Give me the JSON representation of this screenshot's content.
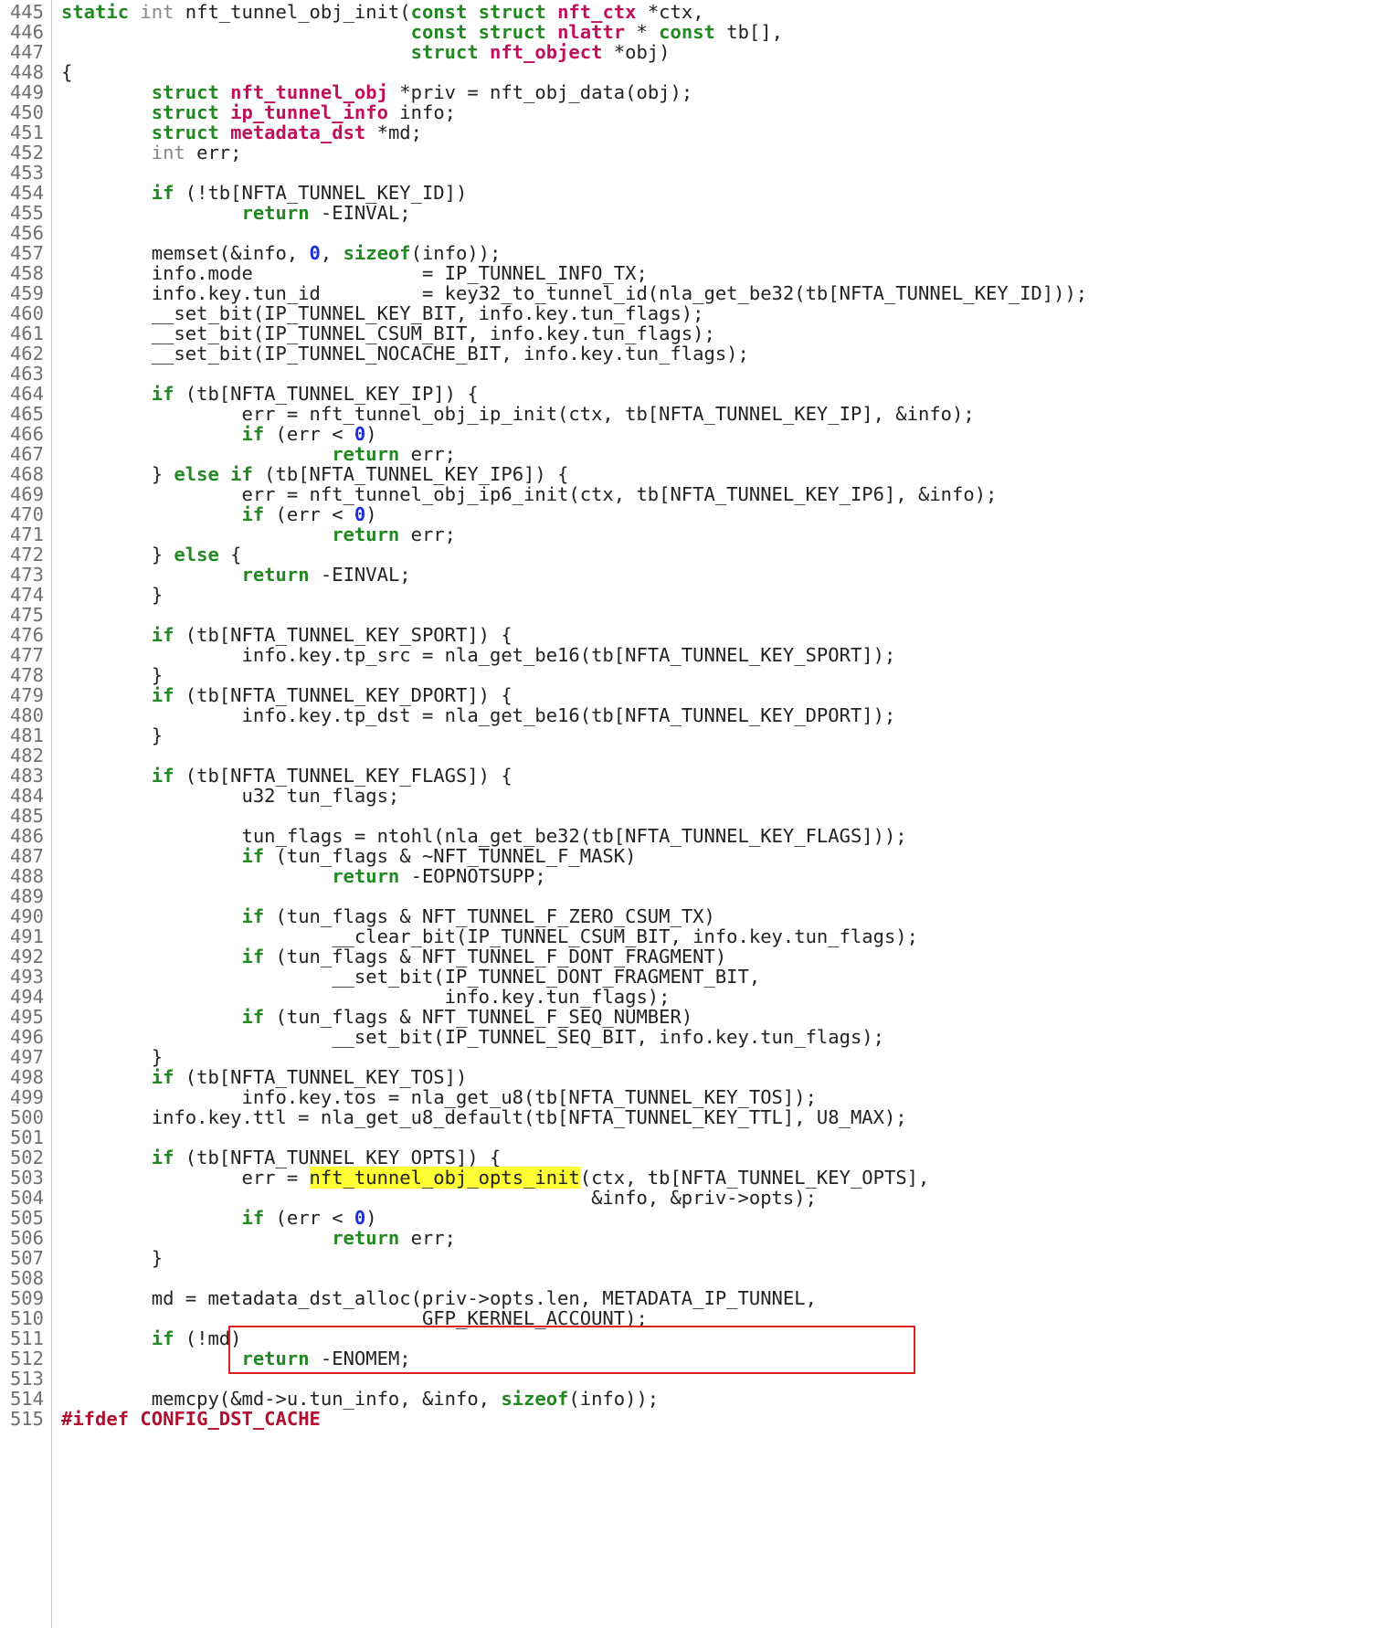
{
  "viewer": {
    "highlight_symbol": "nft_tunnel_obj_opts_init",
    "highlight_color": "#ffff33",
    "box_color": "#e0201c",
    "box_lines": [
      503,
      504
    ]
  },
  "lines": [
    {
      "n": "445",
      "segs": [
        [
          "k",
          "static"
        ],
        [
          "",
          ""
        ],
        [
          "t",
          " int"
        ],
        [
          "",
          " nft_tunnel_obj_init("
        ],
        [
          "k",
          "const"
        ],
        [
          "",
          " "
        ],
        [
          "k",
          "struct"
        ],
        [
          "",
          " "
        ],
        [
          "s",
          "nft_ctx"
        ],
        [
          "",
          " *ctx,"
        ]
      ]
    },
    {
      "n": "446",
      "segs": [
        [
          "",
          "                               "
        ],
        [
          "k",
          "const"
        ],
        [
          "",
          " "
        ],
        [
          "k",
          "struct"
        ],
        [
          "",
          " "
        ],
        [
          "s",
          "nlattr"
        ],
        [
          "",
          " * "
        ],
        [
          "k",
          "const"
        ],
        [
          "",
          " tb[],"
        ]
      ]
    },
    {
      "n": "447",
      "segs": [
        [
          "",
          "                               "
        ],
        [
          "k",
          "struct"
        ],
        [
          "",
          " "
        ],
        [
          "s",
          "nft_object"
        ],
        [
          "",
          " *obj)"
        ]
      ]
    },
    {
      "n": "448",
      "segs": [
        [
          "",
          "{"
        ]
      ]
    },
    {
      "n": "449",
      "segs": [
        [
          "",
          "        "
        ],
        [
          "k",
          "struct"
        ],
        [
          "",
          " "
        ],
        [
          "s",
          "nft_tunnel_obj"
        ],
        [
          "",
          " *priv = nft_obj_data(obj);"
        ]
      ]
    },
    {
      "n": "450",
      "segs": [
        [
          "",
          "        "
        ],
        [
          "k",
          "struct"
        ],
        [
          "",
          " "
        ],
        [
          "s",
          "ip_tunnel_info"
        ],
        [
          "",
          " info;"
        ]
      ]
    },
    {
      "n": "451",
      "segs": [
        [
          "",
          "        "
        ],
        [
          "k",
          "struct"
        ],
        [
          "",
          " "
        ],
        [
          "s",
          "metadata_dst"
        ],
        [
          "",
          " *md;"
        ]
      ]
    },
    {
      "n": "452",
      "segs": [
        [
          "",
          "        "
        ],
        [
          "t",
          "int"
        ],
        [
          "",
          " err;"
        ]
      ]
    },
    {
      "n": "453",
      "segs": [
        [
          "",
          ""
        ]
      ]
    },
    {
      "n": "454",
      "segs": [
        [
          "",
          "        "
        ],
        [
          "k",
          "if"
        ],
        [
          "",
          " (!tb[NFTA_TUNNEL_KEY_ID])"
        ]
      ]
    },
    {
      "n": "455",
      "segs": [
        [
          "",
          "                "
        ],
        [
          "k",
          "return"
        ],
        [
          "",
          " -EINVAL;"
        ]
      ]
    },
    {
      "n": "456",
      "segs": [
        [
          "",
          ""
        ]
      ]
    },
    {
      "n": "457",
      "segs": [
        [
          "",
          "        memset(&info, "
        ],
        [
          "n",
          "0"
        ],
        [
          "",
          ", "
        ],
        [
          "k",
          "sizeof"
        ],
        [
          "",
          "(info));"
        ]
      ]
    },
    {
      "n": "458",
      "segs": [
        [
          "",
          "        info.mode               = IP_TUNNEL_INFO_TX;"
        ]
      ]
    },
    {
      "n": "459",
      "segs": [
        [
          "",
          "        info.key.tun_id         = key32_to_tunnel_id(nla_get_be32(tb[NFTA_TUNNEL_KEY_ID]));"
        ]
      ]
    },
    {
      "n": "460",
      "segs": [
        [
          "",
          "        __set_bit(IP_TUNNEL_KEY_BIT, info.key.tun_flags);"
        ]
      ]
    },
    {
      "n": "461",
      "segs": [
        [
          "",
          "        __set_bit(IP_TUNNEL_CSUM_BIT, info.key.tun_flags);"
        ]
      ]
    },
    {
      "n": "462",
      "segs": [
        [
          "",
          "        __set_bit(IP_TUNNEL_NOCACHE_BIT, info.key.tun_flags);"
        ]
      ]
    },
    {
      "n": "463",
      "segs": [
        [
          "",
          ""
        ]
      ]
    },
    {
      "n": "464",
      "segs": [
        [
          "",
          "        "
        ],
        [
          "k",
          "if"
        ],
        [
          "",
          " (tb[NFTA_TUNNEL_KEY_IP]) {"
        ]
      ]
    },
    {
      "n": "465",
      "segs": [
        [
          "",
          "                err = nft_tunnel_obj_ip_init(ctx, tb[NFTA_TUNNEL_KEY_IP], &info);"
        ]
      ]
    },
    {
      "n": "466",
      "segs": [
        [
          "",
          "                "
        ],
        [
          "k",
          "if"
        ],
        [
          "",
          " (err < "
        ],
        [
          "n",
          "0"
        ],
        [
          "",
          ")"
        ]
      ]
    },
    {
      "n": "467",
      "segs": [
        [
          "",
          "                        "
        ],
        [
          "k",
          "return"
        ],
        [
          "",
          " err;"
        ]
      ]
    },
    {
      "n": "468",
      "segs": [
        [
          "",
          "        } "
        ],
        [
          "k",
          "else"
        ],
        [
          "",
          " "
        ],
        [
          "k",
          "if"
        ],
        [
          "",
          " (tb[NFTA_TUNNEL_KEY_IP6]) {"
        ]
      ]
    },
    {
      "n": "469",
      "segs": [
        [
          "",
          "                err = nft_tunnel_obj_ip6_init(ctx, tb[NFTA_TUNNEL_KEY_IP6], &info);"
        ]
      ]
    },
    {
      "n": "470",
      "segs": [
        [
          "",
          "                "
        ],
        [
          "k",
          "if"
        ],
        [
          "",
          " (err < "
        ],
        [
          "n",
          "0"
        ],
        [
          "",
          ")"
        ]
      ]
    },
    {
      "n": "471",
      "segs": [
        [
          "",
          "                        "
        ],
        [
          "k",
          "return"
        ],
        [
          "",
          " err;"
        ]
      ]
    },
    {
      "n": "472",
      "segs": [
        [
          "",
          "        } "
        ],
        [
          "k",
          "else"
        ],
        [
          "",
          " {"
        ]
      ]
    },
    {
      "n": "473",
      "segs": [
        [
          "",
          "                "
        ],
        [
          "k",
          "return"
        ],
        [
          "",
          " -EINVAL;"
        ]
      ]
    },
    {
      "n": "474",
      "segs": [
        [
          "",
          "        }"
        ]
      ]
    },
    {
      "n": "475",
      "segs": [
        [
          "",
          ""
        ]
      ]
    },
    {
      "n": "476",
      "segs": [
        [
          "",
          "        "
        ],
        [
          "k",
          "if"
        ],
        [
          "",
          " (tb[NFTA_TUNNEL_KEY_SPORT]) {"
        ]
      ]
    },
    {
      "n": "477",
      "segs": [
        [
          "",
          "                info.key.tp_src = nla_get_be16(tb[NFTA_TUNNEL_KEY_SPORT]);"
        ]
      ]
    },
    {
      "n": "478",
      "segs": [
        [
          "",
          "        }"
        ]
      ]
    },
    {
      "n": "479",
      "segs": [
        [
          "",
          "        "
        ],
        [
          "k",
          "if"
        ],
        [
          "",
          " (tb[NFTA_TUNNEL_KEY_DPORT]) {"
        ]
      ]
    },
    {
      "n": "480",
      "segs": [
        [
          "",
          "                info.key.tp_dst = nla_get_be16(tb[NFTA_TUNNEL_KEY_DPORT]);"
        ]
      ]
    },
    {
      "n": "481",
      "segs": [
        [
          "",
          "        }"
        ]
      ]
    },
    {
      "n": "482",
      "segs": [
        [
          "",
          ""
        ]
      ]
    },
    {
      "n": "483",
      "segs": [
        [
          "",
          "        "
        ],
        [
          "k",
          "if"
        ],
        [
          "",
          " (tb[NFTA_TUNNEL_KEY_FLAGS]) {"
        ]
      ]
    },
    {
      "n": "484",
      "segs": [
        [
          "",
          "                u32 tun_flags;"
        ]
      ]
    },
    {
      "n": "485",
      "segs": [
        [
          "",
          ""
        ]
      ]
    },
    {
      "n": "486",
      "segs": [
        [
          "",
          "                tun_flags = ntohl(nla_get_be32(tb[NFTA_TUNNEL_KEY_FLAGS]));"
        ]
      ]
    },
    {
      "n": "487",
      "segs": [
        [
          "",
          "                "
        ],
        [
          "k",
          "if"
        ],
        [
          "",
          " (tun_flags & ~NFT_TUNNEL_F_MASK)"
        ]
      ]
    },
    {
      "n": "488",
      "segs": [
        [
          "",
          "                        "
        ],
        [
          "k",
          "return"
        ],
        [
          "",
          " -EOPNOTSUPP;"
        ]
      ]
    },
    {
      "n": "489",
      "segs": [
        [
          "",
          ""
        ]
      ]
    },
    {
      "n": "490",
      "segs": [
        [
          "",
          "                "
        ],
        [
          "k",
          "if"
        ],
        [
          "",
          " (tun_flags & NFT_TUNNEL_F_ZERO_CSUM_TX)"
        ]
      ]
    },
    {
      "n": "491",
      "segs": [
        [
          "",
          "                        __clear_bit(IP_TUNNEL_CSUM_BIT, info.key.tun_flags);"
        ]
      ]
    },
    {
      "n": "492",
      "segs": [
        [
          "",
          "                "
        ],
        [
          "k",
          "if"
        ],
        [
          "",
          " (tun_flags & NFT_TUNNEL_F_DONT_FRAGMENT)"
        ]
      ]
    },
    {
      "n": "493",
      "segs": [
        [
          "",
          "                        __set_bit(IP_TUNNEL_DONT_FRAGMENT_BIT,"
        ]
      ]
    },
    {
      "n": "494",
      "segs": [
        [
          "",
          "                                  info.key.tun_flags);"
        ]
      ]
    },
    {
      "n": "495",
      "segs": [
        [
          "",
          "                "
        ],
        [
          "k",
          "if"
        ],
        [
          "",
          " (tun_flags & NFT_TUNNEL_F_SEQ_NUMBER)"
        ]
      ]
    },
    {
      "n": "496",
      "segs": [
        [
          "",
          "                        __set_bit(IP_TUNNEL_SEQ_BIT, info.key.tun_flags);"
        ]
      ]
    },
    {
      "n": "497",
      "segs": [
        [
          "",
          "        }"
        ]
      ]
    },
    {
      "n": "498",
      "segs": [
        [
          "",
          "        "
        ],
        [
          "k",
          "if"
        ],
        [
          "",
          " (tb[NFTA_TUNNEL_KEY_TOS])"
        ]
      ]
    },
    {
      "n": "499",
      "segs": [
        [
          "",
          "                info.key.tos = nla_get_u8(tb[NFTA_TUNNEL_KEY_TOS]);"
        ]
      ]
    },
    {
      "n": "500",
      "segs": [
        [
          "",
          "        info.key.ttl = nla_get_u8_default(tb[NFTA_TUNNEL_KEY_TTL], U8_MAX);"
        ]
      ]
    },
    {
      "n": "501",
      "segs": [
        [
          "",
          ""
        ]
      ]
    },
    {
      "n": "502",
      "segs": [
        [
          "",
          "        "
        ],
        [
          "k",
          "if"
        ],
        [
          "",
          " (tb[NFTA_TUNNEL_KEY_OPTS]) {"
        ]
      ]
    },
    {
      "n": "503",
      "segs": [
        [
          "",
          "                err = "
        ],
        [
          "hl",
          "nft_tunnel_obj_opts_init"
        ],
        [
          "",
          "(ctx, tb[NFTA_TUNNEL_KEY_OPTS],"
        ]
      ]
    },
    {
      "n": "504",
      "segs": [
        [
          "",
          "                                               &info, &priv->opts);"
        ]
      ]
    },
    {
      "n": "505",
      "segs": [
        [
          "",
          "                "
        ],
        [
          "k",
          "if"
        ],
        [
          "",
          " (err < "
        ],
        [
          "n",
          "0"
        ],
        [
          "",
          ")"
        ]
      ]
    },
    {
      "n": "506",
      "segs": [
        [
          "",
          "                        "
        ],
        [
          "k",
          "return"
        ],
        [
          "",
          " err;"
        ]
      ]
    },
    {
      "n": "507",
      "segs": [
        [
          "",
          "        }"
        ]
      ]
    },
    {
      "n": "508",
      "segs": [
        [
          "",
          ""
        ]
      ]
    },
    {
      "n": "509",
      "segs": [
        [
          "",
          "        md = metadata_dst_alloc(priv->opts.len, METADATA_IP_TUNNEL,"
        ]
      ]
    },
    {
      "n": "510",
      "segs": [
        [
          "",
          "                                GFP_KERNEL_ACCOUNT);"
        ]
      ]
    },
    {
      "n": "511",
      "segs": [
        [
          "",
          "        "
        ],
        [
          "k",
          "if"
        ],
        [
          "",
          " (!md)"
        ]
      ]
    },
    {
      "n": "512",
      "segs": [
        [
          "",
          "                "
        ],
        [
          "k",
          "return"
        ],
        [
          "",
          " -ENOMEM;"
        ]
      ]
    },
    {
      "n": "513",
      "segs": [
        [
          "",
          ""
        ]
      ]
    },
    {
      "n": "514",
      "segs": [
        [
          "",
          "        memcpy(&md->u.tun_info, &info, "
        ],
        [
          "k",
          "sizeof"
        ],
        [
          "",
          "(info));"
        ]
      ]
    },
    {
      "n": "515",
      "segs": [
        [
          "p",
          "#ifdef"
        ],
        [
          "",
          " "
        ],
        [
          "p",
          "CONFIG_DST_CACHE"
        ]
      ]
    }
  ]
}
